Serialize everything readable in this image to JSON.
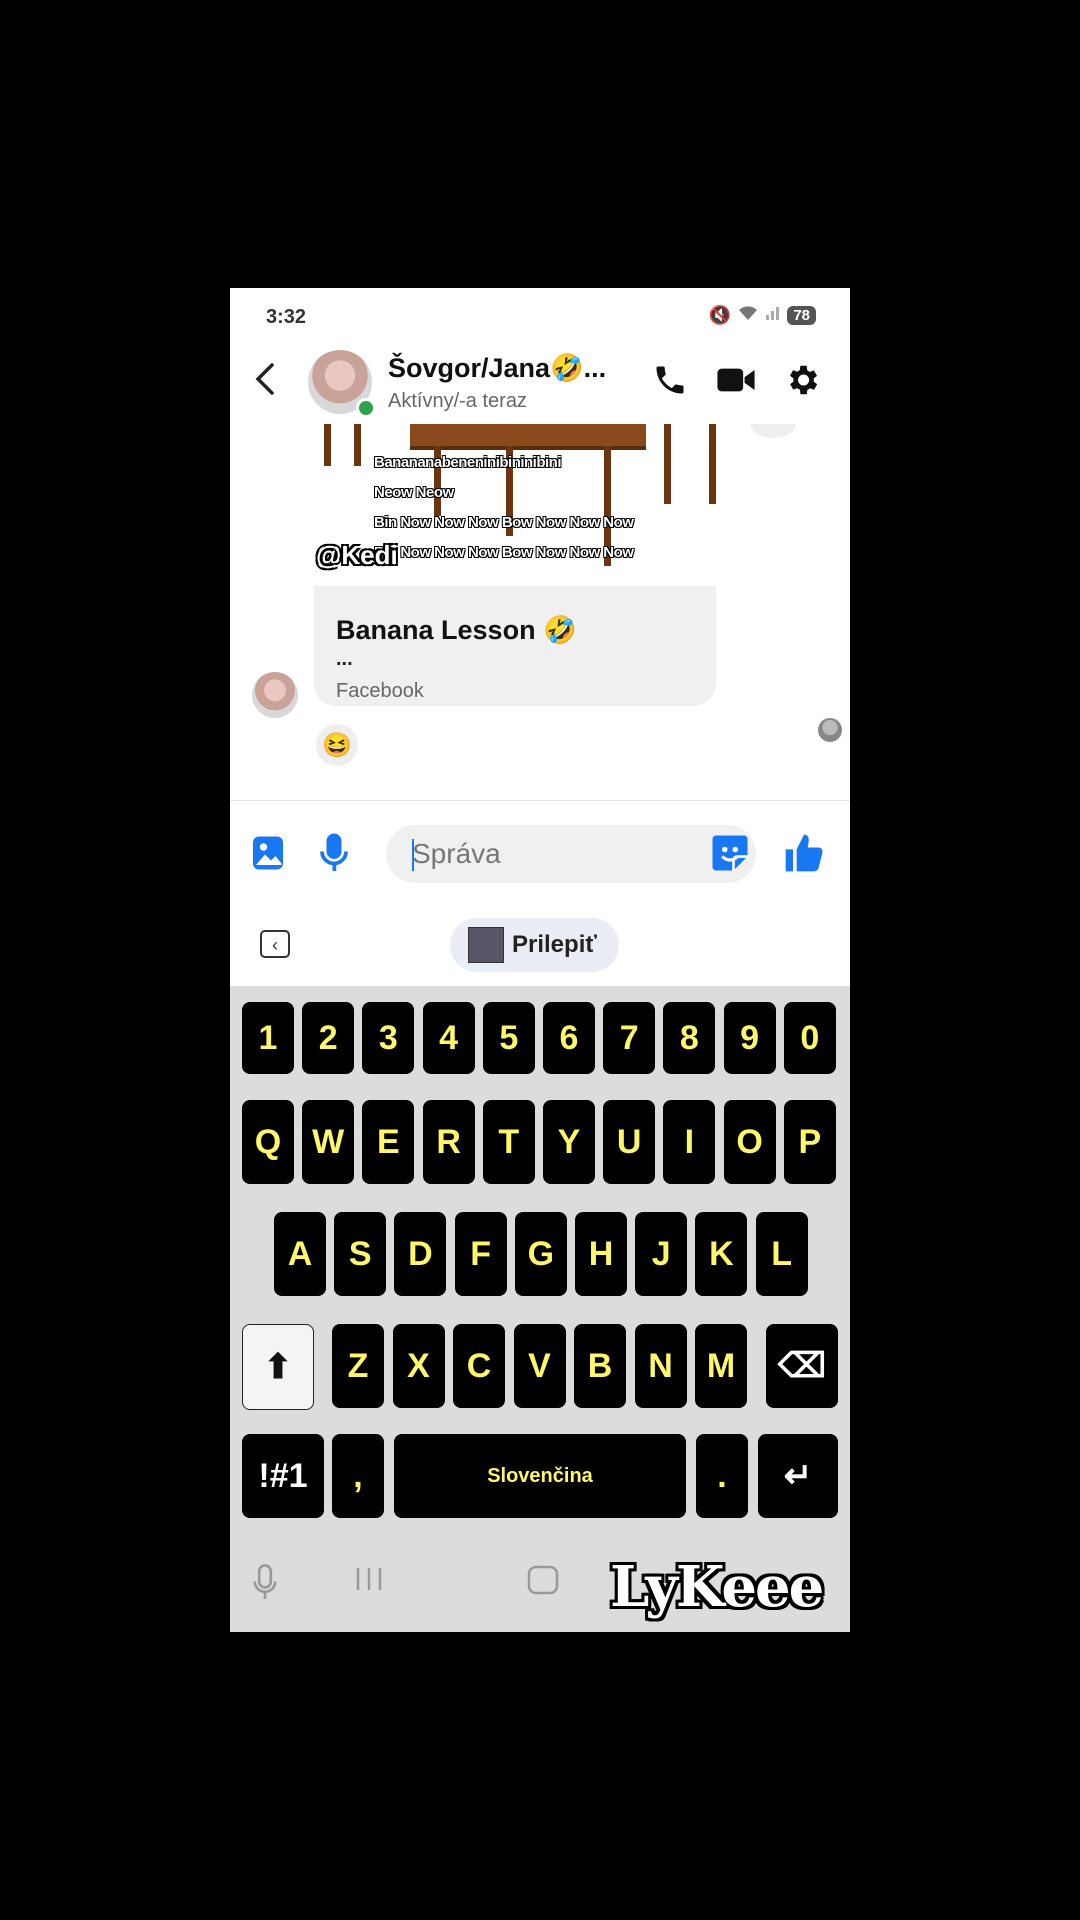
{
  "status_bar": {
    "time": "3:32",
    "battery": "78"
  },
  "header": {
    "contact_name": "Šovgor/Jana🤣...",
    "contact_status": "Aktívny/-a teraz"
  },
  "chat": {
    "meme_lines": [
      "Banananabeneninibininibini",
      "Neow Neow",
      "Bin Now Now Now Bow Now Now Now",
      "Bin Now Now Now Bow Now Now Now"
    ],
    "meme_handle": "@Kedi",
    "link_card": {
      "title": "Banana Lesson 🤣",
      "description": "...",
      "source": "Facebook"
    },
    "reaction": "😆"
  },
  "composer": {
    "placeholder": "Správa"
  },
  "suggestion_bar": {
    "paste_label": "Prilepiť"
  },
  "keyboard": {
    "row_numbers": [
      "1",
      "2",
      "3",
      "4",
      "5",
      "6",
      "7",
      "8",
      "9",
      "0"
    ],
    "row_top": [
      "Q",
      "W",
      "E",
      "R",
      "T",
      "Y",
      "U",
      "I",
      "O",
      "P"
    ],
    "row_middle": [
      "A",
      "S",
      "D",
      "F",
      "G",
      "H",
      "J",
      "K",
      "L"
    ],
    "row_bottom": [
      "Z",
      "X",
      "C",
      "V",
      "B",
      "N",
      "M"
    ],
    "symbols_label": "!#1",
    "comma_label": ",",
    "space_label": "Slovenčina",
    "period_label": ".",
    "enter_glyph": "↵",
    "shift_glyph": "⬆",
    "backspace_glyph": "⌫"
  },
  "watermark": "LyKeee",
  "colors": {
    "accent": "#1877f2",
    "key_text": "#fff76a",
    "key_bg": "#000000",
    "online": "#31a24c"
  }
}
